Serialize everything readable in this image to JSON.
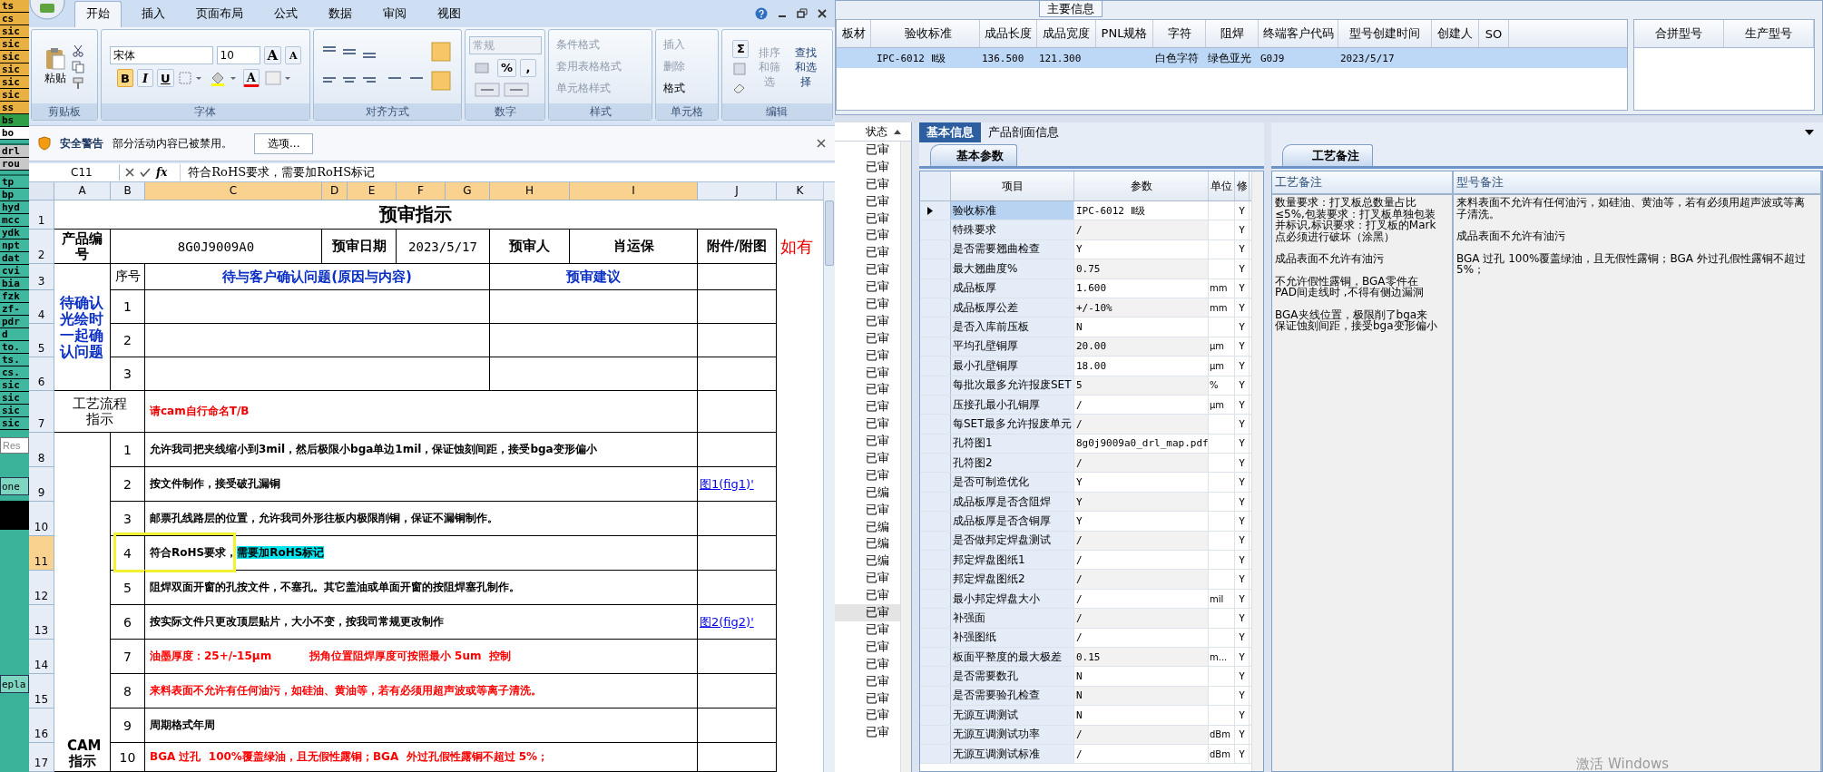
{
  "left_strip": {
    "items": [
      {
        "label": "ts",
        "color": "#e8b040"
      },
      {
        "label": "cs",
        "color": "#e8b040"
      },
      {
        "label": "sic",
        "color": "#e8b040"
      },
      {
        "label": "sic",
        "color": "#e8b040"
      },
      {
        "label": "sic",
        "color": "#e8b040"
      },
      {
        "label": "sic",
        "color": "#e8b040"
      },
      {
        "label": "sic",
        "color": "#e8b040"
      },
      {
        "label": "sic",
        "color": "#e8b040"
      },
      {
        "label": "ss",
        "color": "#e8b040"
      },
      {
        "label": "bs",
        "color": "#2f9e48"
      },
      {
        "label": "bo",
        "color": "#ffffff"
      },
      {
        "label": "drl",
        "color": "#c8c8c8"
      },
      {
        "label": "rou",
        "color": "#c8c8c8"
      },
      {
        "label": "tp",
        "color": "#40b8a0"
      },
      {
        "label": "bp",
        "color": "#40b8a0"
      },
      {
        "label": "hyd",
        "color": "#40b8a0"
      },
      {
        "label": "mcc",
        "color": "#40b8a0"
      },
      {
        "label": "ydk",
        "color": "#40b8a0"
      },
      {
        "label": "npt",
        "color": "#40b8a0"
      },
      {
        "label": "dat",
        "color": "#40b8a0"
      },
      {
        "label": "cvi",
        "color": "#40b8a0"
      },
      {
        "label": "bia",
        "color": "#40b8a0"
      },
      {
        "label": "fzk",
        "color": "#40b8a0"
      },
      {
        "label": "zf-",
        "color": "#40b8a0"
      },
      {
        "label": "pdr",
        "color": "#40b8a0"
      },
      {
        "label": "d",
        "color": "#40b8a0"
      },
      {
        "label": "to.",
        "color": "#40b8a0"
      },
      {
        "label": "ts.",
        "color": "#40b8a0"
      },
      {
        "label": "cs.",
        "color": "#40b8a0"
      },
      {
        "label": "sic",
        "color": "#40b8a0"
      },
      {
        "label": "sic",
        "color": "#40b8a0"
      },
      {
        "label": "sic",
        "color": "#40b8a0"
      },
      {
        "label": "sic",
        "color": "#40b8a0"
      }
    ],
    "search": {
      "placeholder": "Res"
    },
    "buttons": [
      "one",
      "epla"
    ]
  },
  "excel": {
    "tabs": [
      {
        "label": "开始",
        "selected": true
      },
      {
        "label": "插入",
        "selected": false
      },
      {
        "label": "页面布局",
        "selected": false
      },
      {
        "label": "公式",
        "selected": false
      },
      {
        "label": "数据",
        "selected": false
      },
      {
        "label": "审阅",
        "selected": false
      },
      {
        "label": "视图",
        "selected": false
      }
    ],
    "ribbon": {
      "clipboard": {
        "title": "剪贴板",
        "paste": "粘贴"
      },
      "font": {
        "title": "字体",
        "name": "宋体",
        "size": "10",
        "grow": "A",
        "shrink": "A",
        "color_button": "A",
        "toggles": [
          {
            "label": "B",
            "on": true
          },
          {
            "label": "I",
            "on": false
          },
          {
            "label": "U",
            "on": false
          }
        ]
      },
      "align": {
        "title": "对齐方式"
      },
      "number": {
        "title": "数字",
        "format": "常规",
        "format_disabled": true,
        "percent": "%",
        "comma": ","
      },
      "styles": {
        "title": "样式",
        "items": [
          {
            "label": "条件格式",
            "disabled": true
          },
          {
            "label": "套用表格格式",
            "disabled": true
          },
          {
            "label": "单元格样式",
            "disabled": true
          }
        ]
      },
      "cells": {
        "title": "单元格",
        "items": [
          {
            "label": "插入",
            "disabled": true
          },
          {
            "label": "删除",
            "disabled": true
          },
          {
            "label": "格式",
            "disabled": false
          }
        ]
      },
      "editing": {
        "title": "编辑",
        "sum": "Σ",
        "items": [
          {
            "label": "排序和筛选",
            "disabled": true
          },
          {
            "label": "查找和选择",
            "disabled": false
          }
        ]
      }
    },
    "security": {
      "title": "安全警告",
      "message": "部分活动内容已被禁用。",
      "button": "选项..."
    },
    "formula_bar": {
      "name_box": "C11",
      "fx": "fx",
      "value": "符合RoHS要求，需要加RoHS标记"
    },
    "columns": [
      {
        "label": "A",
        "selected": false
      },
      {
        "label": "B",
        "selected": false
      },
      {
        "label": "C",
        "selected": true
      },
      {
        "label": "D",
        "selected": true
      },
      {
        "label": "E",
        "selected": true
      },
      {
        "label": "F",
        "selected": true
      },
      {
        "label": "G",
        "selected": true
      },
      {
        "label": "H",
        "selected": true
      },
      {
        "label": "I",
        "selected": true
      },
      {
        "label": "J",
        "selected": false
      },
      {
        "label": "K",
        "selected": false
      }
    ],
    "rows": [
      {
        "label": "1",
        "selected": false
      },
      {
        "label": "2",
        "selected": false
      },
      {
        "label": "3",
        "selected": false
      },
      {
        "label": "4",
        "selected": false
      },
      {
        "label": "5",
        "selected": false
      },
      {
        "label": "6",
        "selected": false
      },
      {
        "label": "7",
        "selected": false
      },
      {
        "label": "8",
        "selected": false
      },
      {
        "label": "9",
        "selected": false
      },
      {
        "label": "10",
        "selected": false
      },
      {
        "label": "11",
        "selected": true
      },
      {
        "label": "12",
        "selected": false
      },
      {
        "label": "13",
        "selected": false
      },
      {
        "label": "14",
        "selected": false
      },
      {
        "label": "15",
        "selected": false
      },
      {
        "label": "16",
        "selected": false
      },
      {
        "label": "17",
        "selected": false
      }
    ],
    "sheet": {
      "title": "预审指示",
      "header": {
        "product_label": "产品编号",
        "product_no": "8G0J9009A0",
        "date_label": "预审日期",
        "date": "2023/5/17",
        "reviewer_label": "预审人",
        "reviewer": "肖运保",
        "attachment_label": "附件/附图",
        "overflow_note": "如有"
      },
      "confirm": {
        "label": "待确认光绘时一起确认问题",
        "no_header": "序号",
        "question_header": "待与客户确认问题(原因与内容)",
        "advice_header": "预审建议",
        "numbers": [
          "1",
          "2",
          "3"
        ]
      },
      "process": {
        "label": "工艺流程指示",
        "note": "请cam自行命名T/B"
      },
      "cam": {
        "label": "CAM指示",
        "items": [
          {
            "no": "1",
            "text": "允许我司把夹线缩小到3mil，然后极限小bga单边1mil，保证蚀刻间距，接受bga变形偏小",
            "color": "#000000",
            "boxed": false
          },
          {
            "no": "2",
            "text": "按文件制作，接受破孔漏铜",
            "color": "#000000",
            "boxed": false,
            "link": "图1(fig1)'"
          },
          {
            "no": "3",
            "text": "邮票孔线路层的位置，允许我司外形往板内极限削铜，保证不漏铜制作。",
            "color": "#000000",
            "boxed": false
          },
          {
            "no": "4",
            "text": "符合RoHS要求，",
            "highlight": "需要加RoHS标记",
            "color": "#000000",
            "boxed": true
          },
          {
            "no": "5",
            "text": "阻焊双面开窗的孔按文件，不塞孔。其它盖油或单面开窗的按阻焊塞孔制作。",
            "color": "#000000",
            "boxed": false
          },
          {
            "no": "6",
            "text": "按实际文件只更改顶层贴片，大小不变，按我司常规更改制作",
            "color": "#000000",
            "boxed": false,
            "link": "图2(fig2)'"
          },
          {
            "no": "7",
            "text": "油墨厚度：25+/-15μm          拐角位置阻焊厚度可按照最小 5um  控制",
            "color": "#ff0000",
            "boxed": false
          },
          {
            "no": "8",
            "text": "来料表面不允许有任何油污，如硅油、黄油等，若有必须用超声波或等离子清洗。",
            "color": "#ff0000",
            "boxed": false
          },
          {
            "no": "9",
            "text": "周期格式年周",
            "color": "#000000",
            "boxed": false
          },
          {
            "no": "10",
            "text": "BGA 过孔  100%覆盖绿油，且无假性露铜；BGA  外过孔假性露铜不超过 5%；",
            "color": "#ff0000",
            "boxed": false
          }
        ]
      }
    }
  },
  "main_info": {
    "title": "主要信息",
    "row_selected": true,
    "columns": [
      {
        "header": "板材"
      },
      {
        "header": "验收标准",
        "value": "IPC-6012 Ⅱ级"
      },
      {
        "header": "成品长度",
        "value": "136.500"
      },
      {
        "header": "成品宽度",
        "value": "121.300"
      },
      {
        "header": "PNL规格"
      },
      {
        "header": "字符",
        "value": "白色字符"
      },
      {
        "header": "阻焊",
        "value": "绿色亚光"
      },
      {
        "header": "终端客户代码",
        "value": "G0J9"
      },
      {
        "header": "型号创建时间",
        "value": "2023/5/17"
      },
      {
        "header": "创建人"
      },
      {
        "header": "SO"
      }
    ],
    "side_columns": [
      "合拼型号",
      "生产型号"
    ]
  },
  "status_list": {
    "header": "状态",
    "items": [
      {
        "label": "已审",
        "selected": false
      },
      {
        "label": "已审",
        "selected": false
      },
      {
        "label": "已审",
        "selected": false
      },
      {
        "label": "已审",
        "selected": false
      },
      {
        "label": "已审",
        "selected": false
      },
      {
        "label": "已审",
        "selected": false
      },
      {
        "label": "已审",
        "selected": false
      },
      {
        "label": "已审",
        "selected": false
      },
      {
        "label": "已审",
        "selected": false
      },
      {
        "label": "已审",
        "selected": false
      },
      {
        "label": "已审",
        "selected": false
      },
      {
        "label": "已审",
        "selected": false
      },
      {
        "label": "已审",
        "selected": false
      },
      {
        "label": "已审",
        "selected": false
      },
      {
        "label": "已审",
        "selected": false
      },
      {
        "label": "已审",
        "selected": false
      },
      {
        "label": "已审",
        "selected": false
      },
      {
        "label": "已审",
        "selected": false
      },
      {
        "label": "已审",
        "selected": false
      },
      {
        "label": "已审",
        "selected": false
      },
      {
        "label": "已编",
        "selected": false
      },
      {
        "label": "已审",
        "selected": false
      },
      {
        "label": "已编",
        "selected": false
      },
      {
        "label": "已编",
        "selected": false
      },
      {
        "label": "已编",
        "selected": false
      },
      {
        "label": "已审",
        "selected": false
      },
      {
        "label": "已审",
        "selected": false
      },
      {
        "label": "已审",
        "selected": true
      },
      {
        "label": "已审",
        "selected": false
      },
      {
        "label": "已审",
        "selected": false
      },
      {
        "label": "已审",
        "selected": false
      },
      {
        "label": "已审",
        "selected": false
      },
      {
        "label": "已审",
        "selected": false
      },
      {
        "label": "已审",
        "selected": false
      },
      {
        "label": "已审",
        "selected": false
      }
    ]
  },
  "detail": {
    "tabs": [
      {
        "label": "基本信息",
        "selected": true
      },
      {
        "label": "产品剖面信息",
        "selected": false
      }
    ],
    "subtab": "基本参数",
    "columns": [
      "项目",
      "参数",
      "单位",
      "修"
    ],
    "rows": [
      {
        "item": "验收标准",
        "value": "IPC-6012 Ⅱ级",
        "flag": "Y",
        "selected": true
      },
      {
        "item": "特殊要求",
        "value": "/",
        "flag": "Y",
        "selected": false
      },
      {
        "item": "是否需要翘曲检查",
        "value": "Y",
        "flag": "Y",
        "selected": false
      },
      {
        "item": "最大翘曲度%",
        "value": "0.75",
        "flag": "Y",
        "selected": false
      },
      {
        "item": "成品板厚",
        "value": "1.600",
        "unit": "mm",
        "flag": "Y",
        "selected": false
      },
      {
        "item": "成品板厚公差",
        "value": "+/-10%",
        "unit": "mm",
        "flag": "Y",
        "selected": false
      },
      {
        "item": "是否入库前压板",
        "value": "N",
        "flag": "Y",
        "selected": false
      },
      {
        "item": "平均孔壁铜厚",
        "value": "20.00",
        "unit": "μm",
        "flag": "Y",
        "selected": false
      },
      {
        "item": "最小孔壁铜厚",
        "value": "18.00",
        "unit": "μm",
        "flag": "Y",
        "selected": false
      },
      {
        "item": "每批次最多允许报废SET",
        "value": "5",
        "unit": "%",
        "flag": "Y",
        "selected": false
      },
      {
        "item": "压接孔最小孔铜厚",
        "value": "/",
        "unit": "μm",
        "flag": "Y",
        "selected": false
      },
      {
        "item": "每SET最多允许报废单元",
        "value": "/",
        "flag": "Y",
        "selected": false
      },
      {
        "item": "孔符图1",
        "value": "8g0j9009a0_drl_map.pdf",
        "flag": "Y",
        "selected": false
      },
      {
        "item": "孔符图2",
        "value": "/",
        "flag": "Y",
        "selected": false
      },
      {
        "item": "是否可制造优化",
        "value": "Y",
        "flag": "Y",
        "selected": false
      },
      {
        "item": "成品板厚是否含阻焊",
        "value": "Y",
        "flag": "Y",
        "selected": false
      },
      {
        "item": "成品板厚是否含铜厚",
        "value": "Y",
        "flag": "Y",
        "selected": false
      },
      {
        "item": "是否做邦定焊盘测试",
        "value": "/",
        "flag": "Y",
        "selected": false
      },
      {
        "item": "邦定焊盘图纸1",
        "value": "/",
        "flag": "Y",
        "selected": false
      },
      {
        "item": "邦定焊盘图纸2",
        "value": "/",
        "flag": "Y",
        "selected": false
      },
      {
        "item": "最小邦定焊盘大小",
        "value": "/",
        "unit": "mil",
        "flag": "Y",
        "selected": false
      },
      {
        "item": "补强面",
        "value": "/",
        "flag": "Y",
        "selected": false
      },
      {
        "item": "补强图纸",
        "value": "/",
        "flag": "Y",
        "selected": false
      },
      {
        "item": "板面平整度的最大极差",
        "value": "0.15",
        "unit": "m...",
        "flag": "Y",
        "selected": false
      },
      {
        "item": "是否需要数孔",
        "value": "N",
        "flag": "Y",
        "selected": false
      },
      {
        "item": "是否需要验孔检查",
        "value": "N",
        "flag": "Y",
        "selected": false
      },
      {
        "item": "无源互调测试",
        "value": "N",
        "flag": "Y",
        "selected": false
      },
      {
        "item": "无源互调测试功率",
        "value": "/",
        "unit": "dBm",
        "flag": "Y",
        "selected": false
      },
      {
        "item": "无源互调测试标准",
        "value": "/",
        "unit": "dBm",
        "flag": "Y",
        "selected": false
      }
    ]
  },
  "notes": {
    "tab": "工艺备注",
    "columns": [
      {
        "header": "工艺备注",
        "paragraphs": [
          "数量要求：打叉板总数量占比≤5%,包装要求：打叉板单独包装并标识,标识要求：打叉板的Mark点必须进行破坏（涂黑）",
          "成品表面不允许有油污",
          "不允许假性露铜，BGA零件在PAD间走线时 ,不得有侧边漏洞",
          "BGA夹线位置，极限削了bga来保证蚀刻间距，接受bga变形偏小"
        ]
      },
      {
        "header": "型号备注",
        "paragraphs": [
          "来料表面不允许有任何油污，如硅油、黄油等，若有必须用超声波或等离子清洗。",
          "成品表面不允许有油污",
          "BGA 过孔  100%覆盖绿油，且无假性露铜；BGA  外过孔假性露铜不超过5%；"
        ]
      }
    ]
  },
  "activation_notice": "激活 Windows"
}
